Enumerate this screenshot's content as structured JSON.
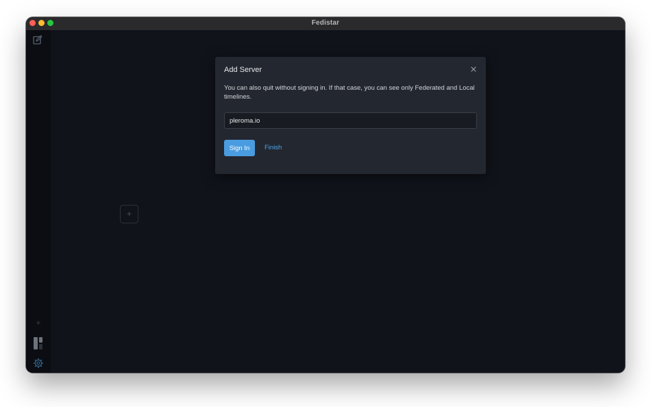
{
  "window": {
    "title": "Fedistar"
  },
  "sidebar": {
    "compose_icon": "compose-icon",
    "add_icon": "plus-icon",
    "columns_icon": "columns-layout-icon",
    "settings_icon": "gear-icon",
    "add_label": "+"
  },
  "main": {
    "add_column_label": "+"
  },
  "dialog": {
    "title": "Add Server",
    "description": "You can also quit without signing in. If that case, you can see only Federated and Local timelines.",
    "server_value": "pleroma.io",
    "sign_in_label": "Sign In",
    "finish_label": "Finish",
    "close_icon": "close-icon"
  },
  "colors": {
    "accent": "#4a9ce0",
    "link": "#4ea6ea",
    "background": "#10131a",
    "dialog": "#23272f"
  }
}
